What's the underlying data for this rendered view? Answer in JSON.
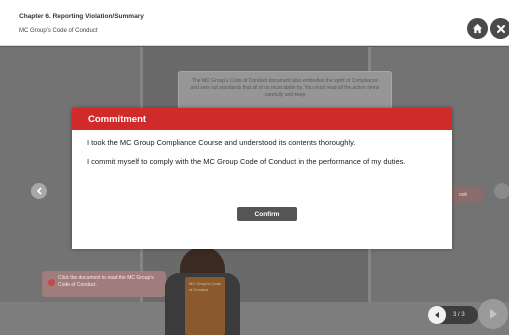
{
  "header": {
    "chapter_title": "Chapter 6. Reporting Violation/Summary",
    "subtitle": "MC Group's Code of Conduct",
    "home_icon": "home-icon",
    "close_icon": "close-icon"
  },
  "scene": {
    "document_text": "The MC Group's Code of Conduct document also embodies the spirit of Compliance and sets out standards that all of us must abide by. You must read all the action items carefully and keep",
    "right_button_label": "ook",
    "hint_text": "Click the document to read the MC Group's Code of Conduct.",
    "folder_text": "MC Group's Code of Conduct"
  },
  "modal": {
    "title": "Commitment",
    "line1": "I took the MC Group Compliance Course and understood its contents thoroughly.",
    "line2": "I commit myself to comply with the MC Group Code of Conduct in the performance of my duties.",
    "confirm_label": "Confirm"
  },
  "pager": {
    "page_indicator": "3 / 3"
  },
  "colors": {
    "accent": "#d12a2a",
    "button": "#555555"
  }
}
